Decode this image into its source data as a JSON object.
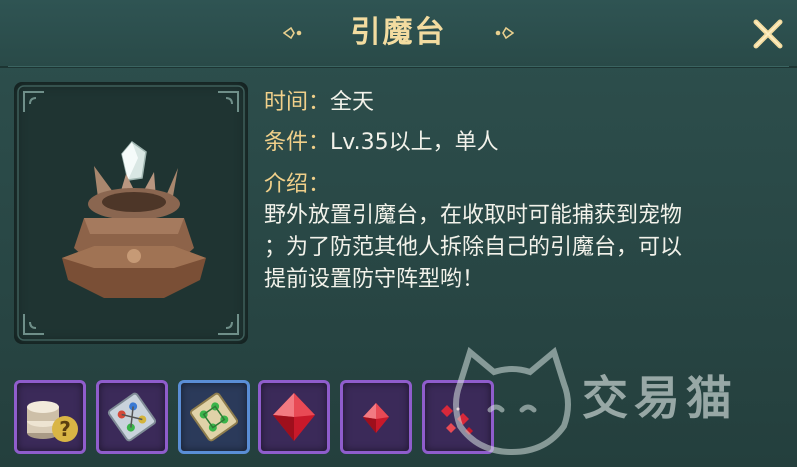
{
  "dialog": {
    "title": "引魔台"
  },
  "info": {
    "time_label": "时间：",
    "time_value": "全天",
    "cond_label": "条件：",
    "cond_value": "Lv.35以上，单人",
    "intro_label": "介绍：",
    "desc_lines": [
      "野外放置引魔台，在收取时可能捕获到宠物",
      "；为了防范其他人拆除自己的引魔台，可以",
      "提前设置防守阵型哟！"
    ]
  },
  "rewards": [
    {
      "icon": "coin-stack-icon",
      "frame": "purple"
    },
    {
      "icon": "formation-scroll-icon",
      "frame": "purple"
    },
    {
      "icon": "formation-scroll-green-icon",
      "frame": "blue"
    },
    {
      "icon": "red-gem-large-icon",
      "frame": "purple"
    },
    {
      "icon": "red-gem-small-icon",
      "frame": "purple"
    },
    {
      "icon": "red-gem-fragments-icon",
      "frame": "purple"
    }
  ],
  "watermark": {
    "text": "交易猫"
  },
  "colors": {
    "title": "#f3dca0",
    "label": "#f1d08a",
    "text": "#f2f2ea",
    "panel": "#2b4a48"
  }
}
